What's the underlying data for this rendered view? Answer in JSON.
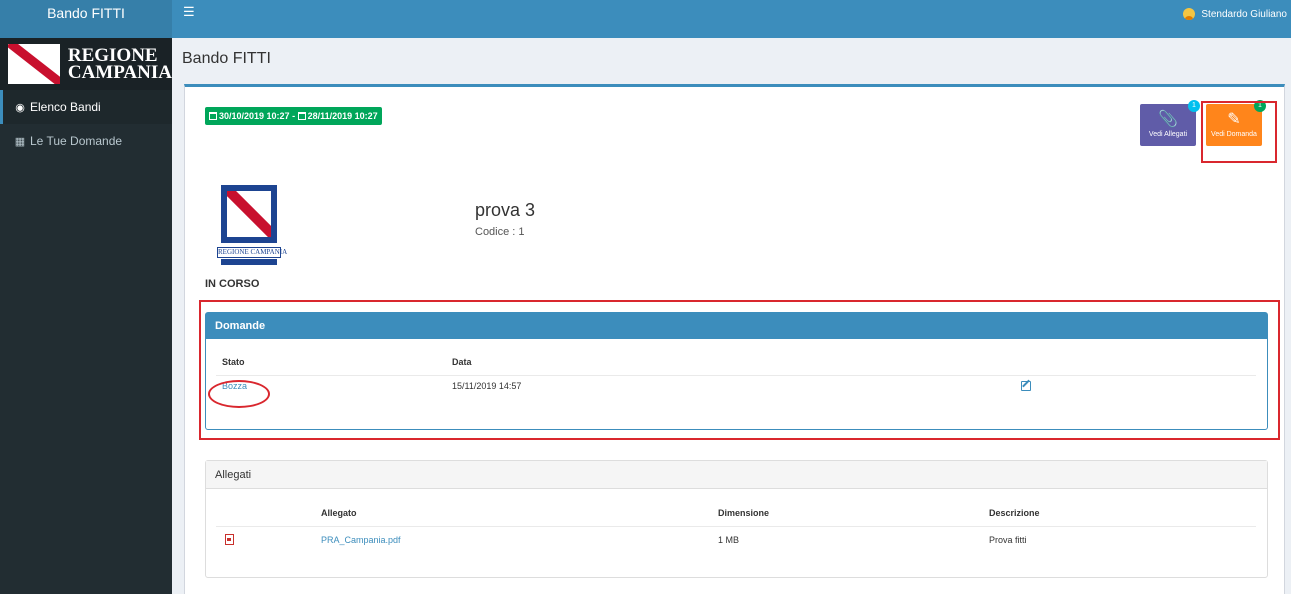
{
  "app": {
    "brand": "Bando FITTI",
    "user_name": "Stendardo Giuliano"
  },
  "sidebar": {
    "logo_line1": "REGIONE",
    "logo_line2": "CAMPANIA",
    "items": [
      {
        "label": "Elenco Bandi",
        "icon": "dashboard-icon",
        "active": true
      },
      {
        "label": "Le Tue Domande",
        "icon": "table-icon",
        "active": false
      }
    ]
  },
  "header": {
    "title": "Bando FITTI"
  },
  "bando": {
    "date_start": "30/10/2019 10:27",
    "date_sep": "-",
    "date_end": "28/11/2019 10:27",
    "title": "prova 3",
    "code": "Codice : 1",
    "status": "IN CORSO",
    "emblem_text": "REGIONE CAMPANIA"
  },
  "actions": {
    "allegati_label": "Vedi Allegati",
    "allegati_count": "1",
    "domanda_label": "Vedi Domanda",
    "domanda_count": "1"
  },
  "domande": {
    "title": "Domande",
    "columns": [
      "Stato",
      "Data"
    ],
    "rows": [
      {
        "stato": "Bozza",
        "data": "15/11/2019 14:57"
      }
    ]
  },
  "allegati": {
    "title": "Allegati",
    "columns": [
      "Allegato",
      "Dimensione",
      "Descrizione"
    ],
    "rows": [
      {
        "allegato": "PRA_Campania.pdf",
        "dimensione": "1 MB",
        "descrizione": "Prova fitti"
      }
    ]
  },
  "colors": {
    "primary": "#3c8dbc",
    "sidebar": "#222d32",
    "success": "#00a65a",
    "purple": "#605ca8",
    "orange": "#ff851b",
    "highlight": "#d9272e"
  }
}
